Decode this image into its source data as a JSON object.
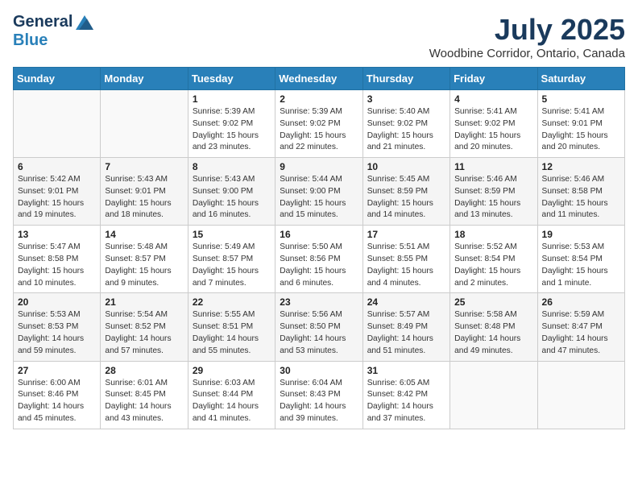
{
  "header": {
    "logo_general": "General",
    "logo_blue": "Blue",
    "month": "July 2025",
    "location": "Woodbine Corridor, Ontario, Canada"
  },
  "days_of_week": [
    "Sunday",
    "Monday",
    "Tuesday",
    "Wednesday",
    "Thursday",
    "Friday",
    "Saturday"
  ],
  "weeks": [
    [
      {
        "day": "",
        "detail": ""
      },
      {
        "day": "",
        "detail": ""
      },
      {
        "day": "1",
        "detail": "Sunrise: 5:39 AM\nSunset: 9:02 PM\nDaylight: 15 hours and 23 minutes."
      },
      {
        "day": "2",
        "detail": "Sunrise: 5:39 AM\nSunset: 9:02 PM\nDaylight: 15 hours and 22 minutes."
      },
      {
        "day": "3",
        "detail": "Sunrise: 5:40 AM\nSunset: 9:02 PM\nDaylight: 15 hours and 21 minutes."
      },
      {
        "day": "4",
        "detail": "Sunrise: 5:41 AM\nSunset: 9:02 PM\nDaylight: 15 hours and 20 minutes."
      },
      {
        "day": "5",
        "detail": "Sunrise: 5:41 AM\nSunset: 9:01 PM\nDaylight: 15 hours and 20 minutes."
      }
    ],
    [
      {
        "day": "6",
        "detail": "Sunrise: 5:42 AM\nSunset: 9:01 PM\nDaylight: 15 hours and 19 minutes."
      },
      {
        "day": "7",
        "detail": "Sunrise: 5:43 AM\nSunset: 9:01 PM\nDaylight: 15 hours and 18 minutes."
      },
      {
        "day": "8",
        "detail": "Sunrise: 5:43 AM\nSunset: 9:00 PM\nDaylight: 15 hours and 16 minutes."
      },
      {
        "day": "9",
        "detail": "Sunrise: 5:44 AM\nSunset: 9:00 PM\nDaylight: 15 hours and 15 minutes."
      },
      {
        "day": "10",
        "detail": "Sunrise: 5:45 AM\nSunset: 8:59 PM\nDaylight: 15 hours and 14 minutes."
      },
      {
        "day": "11",
        "detail": "Sunrise: 5:46 AM\nSunset: 8:59 PM\nDaylight: 15 hours and 13 minutes."
      },
      {
        "day": "12",
        "detail": "Sunrise: 5:46 AM\nSunset: 8:58 PM\nDaylight: 15 hours and 11 minutes."
      }
    ],
    [
      {
        "day": "13",
        "detail": "Sunrise: 5:47 AM\nSunset: 8:58 PM\nDaylight: 15 hours and 10 minutes."
      },
      {
        "day": "14",
        "detail": "Sunrise: 5:48 AM\nSunset: 8:57 PM\nDaylight: 15 hours and 9 minutes."
      },
      {
        "day": "15",
        "detail": "Sunrise: 5:49 AM\nSunset: 8:57 PM\nDaylight: 15 hours and 7 minutes."
      },
      {
        "day": "16",
        "detail": "Sunrise: 5:50 AM\nSunset: 8:56 PM\nDaylight: 15 hours and 6 minutes."
      },
      {
        "day": "17",
        "detail": "Sunrise: 5:51 AM\nSunset: 8:55 PM\nDaylight: 15 hours and 4 minutes."
      },
      {
        "day": "18",
        "detail": "Sunrise: 5:52 AM\nSunset: 8:54 PM\nDaylight: 15 hours and 2 minutes."
      },
      {
        "day": "19",
        "detail": "Sunrise: 5:53 AM\nSunset: 8:54 PM\nDaylight: 15 hours and 1 minute."
      }
    ],
    [
      {
        "day": "20",
        "detail": "Sunrise: 5:53 AM\nSunset: 8:53 PM\nDaylight: 14 hours and 59 minutes."
      },
      {
        "day": "21",
        "detail": "Sunrise: 5:54 AM\nSunset: 8:52 PM\nDaylight: 14 hours and 57 minutes."
      },
      {
        "day": "22",
        "detail": "Sunrise: 5:55 AM\nSunset: 8:51 PM\nDaylight: 14 hours and 55 minutes."
      },
      {
        "day": "23",
        "detail": "Sunrise: 5:56 AM\nSunset: 8:50 PM\nDaylight: 14 hours and 53 minutes."
      },
      {
        "day": "24",
        "detail": "Sunrise: 5:57 AM\nSunset: 8:49 PM\nDaylight: 14 hours and 51 minutes."
      },
      {
        "day": "25",
        "detail": "Sunrise: 5:58 AM\nSunset: 8:48 PM\nDaylight: 14 hours and 49 minutes."
      },
      {
        "day": "26",
        "detail": "Sunrise: 5:59 AM\nSunset: 8:47 PM\nDaylight: 14 hours and 47 minutes."
      }
    ],
    [
      {
        "day": "27",
        "detail": "Sunrise: 6:00 AM\nSunset: 8:46 PM\nDaylight: 14 hours and 45 minutes."
      },
      {
        "day": "28",
        "detail": "Sunrise: 6:01 AM\nSunset: 8:45 PM\nDaylight: 14 hours and 43 minutes."
      },
      {
        "day": "29",
        "detail": "Sunrise: 6:03 AM\nSunset: 8:44 PM\nDaylight: 14 hours and 41 minutes."
      },
      {
        "day": "30",
        "detail": "Sunrise: 6:04 AM\nSunset: 8:43 PM\nDaylight: 14 hours and 39 minutes."
      },
      {
        "day": "31",
        "detail": "Sunrise: 6:05 AM\nSunset: 8:42 PM\nDaylight: 14 hours and 37 minutes."
      },
      {
        "day": "",
        "detail": ""
      },
      {
        "day": "",
        "detail": ""
      }
    ]
  ]
}
